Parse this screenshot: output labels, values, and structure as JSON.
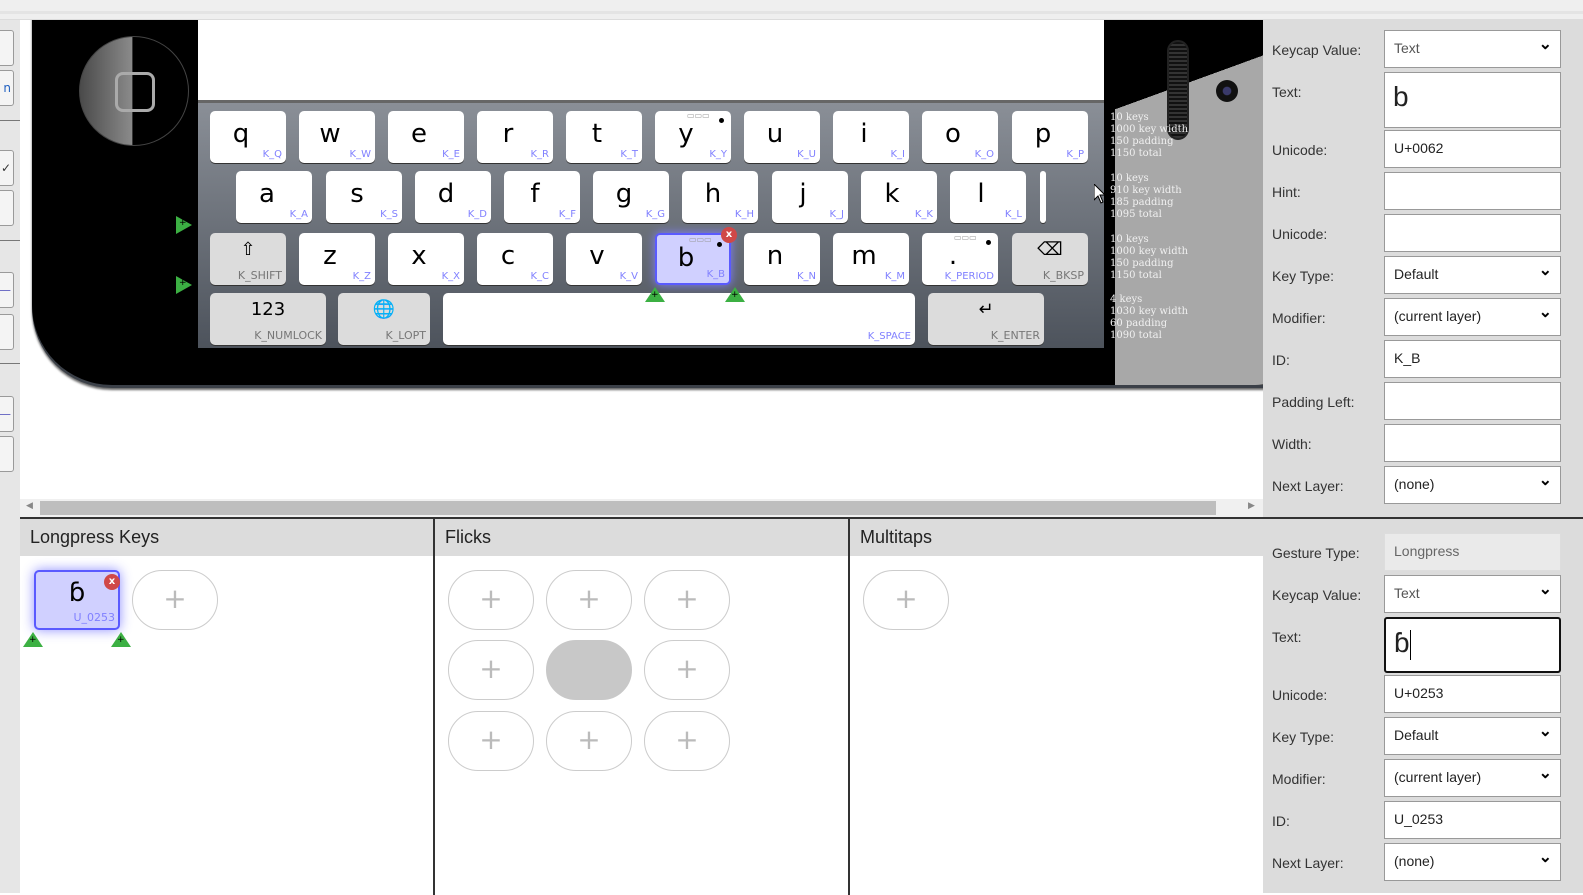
{
  "left_strip": {
    "boxes": [
      "",
      "n",
      "",
      "✓",
      "",
      "—",
      "",
      "—",
      ""
    ]
  },
  "keyboard": {
    "rows": [
      {
        "keys": [
          {
            "cap": "q",
            "id": "K_Q"
          },
          {
            "cap": "w",
            "id": "K_W"
          },
          {
            "cap": "e",
            "id": "K_E"
          },
          {
            "cap": "r",
            "id": "K_R"
          },
          {
            "cap": "t",
            "id": "K_T"
          },
          {
            "cap": "y",
            "id": "K_Y",
            "has_longpress": true,
            "has_flick": true
          },
          {
            "cap": "u",
            "id": "K_U"
          },
          {
            "cap": "i",
            "id": "K_I"
          },
          {
            "cap": "o",
            "id": "K_O"
          },
          {
            "cap": "p",
            "id": "K_P"
          }
        ]
      },
      {
        "keys": [
          {
            "cap": "a",
            "id": "K_A"
          },
          {
            "cap": "s",
            "id": "K_S"
          },
          {
            "cap": "d",
            "id": "K_D"
          },
          {
            "cap": "f",
            "id": "K_F"
          },
          {
            "cap": "g",
            "id": "K_G"
          },
          {
            "cap": "h",
            "id": "K_H"
          },
          {
            "cap": "j",
            "id": "K_J"
          },
          {
            "cap": "k",
            "id": "K_K"
          },
          {
            "cap": "l",
            "id": "K_L"
          }
        ]
      },
      {
        "keys": [
          {
            "cap": "⇧",
            "id": "K_SHIFT",
            "special": true
          },
          {
            "cap": "z",
            "id": "K_Z"
          },
          {
            "cap": "x",
            "id": "K_X"
          },
          {
            "cap": "c",
            "id": "K_C"
          },
          {
            "cap": "v",
            "id": "K_V"
          },
          {
            "cap": "b",
            "id": "K_B",
            "selected": true,
            "has_longpress": true,
            "has_flick": true
          },
          {
            "cap": "n",
            "id": "K_N"
          },
          {
            "cap": "m",
            "id": "K_M"
          },
          {
            "cap": ".",
            "id": "K_PERIOD",
            "has_longpress": true,
            "has_flick": true
          },
          {
            "cap": "⌫",
            "id": "K_BKSP",
            "special": true
          }
        ]
      },
      {
        "keys": [
          {
            "cap": "123",
            "id": "K_NUMLOCK",
            "special": true
          },
          {
            "cap": "🌐",
            "id": "K_LOPT",
            "special": true
          },
          {
            "cap": "",
            "id": "K_SPACE"
          },
          {
            "cap": "↵",
            "id": "K_ENTER",
            "special": true
          }
        ]
      }
    ],
    "row_info": [
      [
        "10 keys",
        "1000 key width",
        "150 padding",
        "1150 total"
      ],
      [
        "10 keys",
        "910 key width",
        "185 padding",
        "1095 total"
      ],
      [
        "10 keys",
        "1000 key width",
        "150 padding",
        "1150 total"
      ],
      [
        "4 keys",
        "1030 key width",
        "60 padding",
        "1090 total"
      ]
    ],
    "delete_badge": "x",
    "add_marker": "+"
  },
  "key_properties": {
    "keycap_value": {
      "label": "Keycap Value:",
      "value": "Text"
    },
    "text": {
      "label": "Text:",
      "value": "b"
    },
    "unicode": {
      "label": "Unicode:",
      "value": "U+0062"
    },
    "hint": {
      "label": "Hint:",
      "value": ""
    },
    "hint_unicode": {
      "label": "Unicode:",
      "value": ""
    },
    "key_type": {
      "label": "Key Type:",
      "value": "Default"
    },
    "modifier": {
      "label": "Modifier:",
      "value": "(current layer)"
    },
    "id": {
      "label": "ID:",
      "value": "K_B"
    },
    "padding_left": {
      "label": "Padding Left:",
      "value": ""
    },
    "width": {
      "label": "Width:",
      "value": ""
    },
    "next_layer": {
      "label": "Next Layer:",
      "value": "(none)"
    }
  },
  "gesture_panels": {
    "longpress": {
      "title": "Longpress Keys",
      "keys": [
        {
          "cap": "ɓ",
          "id": "U_0253"
        }
      ],
      "add_label": "+"
    },
    "flicks": {
      "title": "Flicks",
      "add_label": "+"
    },
    "multitaps": {
      "title": "Multitaps",
      "add_label": "+"
    }
  },
  "gesture_properties": {
    "gesture_type": {
      "label": "Gesture Type:",
      "value": "Longpress"
    },
    "keycap_value": {
      "label": "Keycap Value:",
      "value": "Text"
    },
    "text": {
      "label": "Text:",
      "value": "ɓ"
    },
    "unicode": {
      "label": "Unicode:",
      "value": "U+0253"
    },
    "key_type": {
      "label": "Key Type:",
      "value": "Default"
    },
    "modifier": {
      "label": "Modifier:",
      "value": "(current layer)"
    },
    "id": {
      "label": "ID:",
      "value": "U_0253"
    },
    "next_layer": {
      "label": "Next Layer:",
      "value": "(none)"
    }
  },
  "colors": {
    "selected_key_bg": "#d0d0ff",
    "selected_key_border": "#5a5aff",
    "key_id_text": "#8080ff",
    "add_marker": "#3cb043",
    "delete_badge": "#d04848"
  }
}
